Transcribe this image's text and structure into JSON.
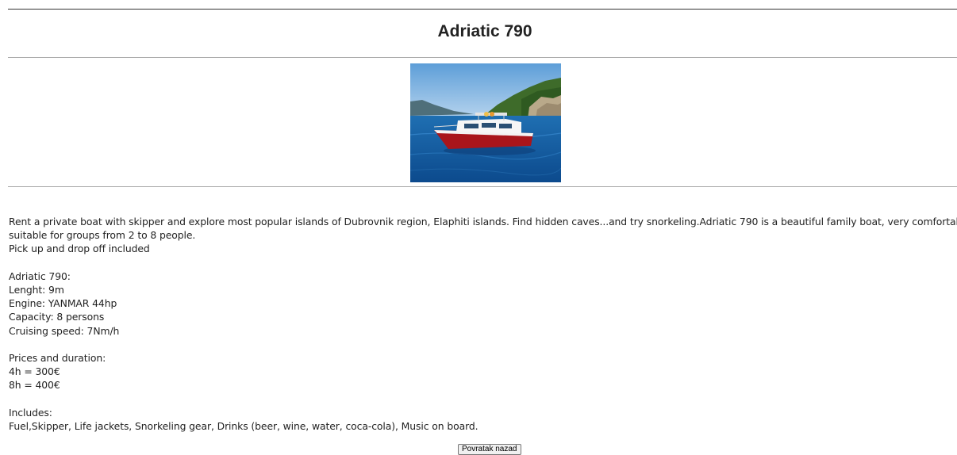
{
  "page": {
    "title": "Adriatic 790"
  },
  "image": {
    "description_icon": "boat-photo"
  },
  "description": {
    "intro_line1": "Rent a private boat with skipper and explore most popular islands of Dubrovnik region, Elaphiti islands. Find hidden caves...and try snorkeling.Adriatic 790 is a beautiful family boat, very comfortable and",
    "intro_line2": "suitable for groups from 2 to 8 people.",
    "intro_line3": "Pick up and drop off included"
  },
  "specs": {
    "heading": "Adriatic 790:",
    "length": "Lenght: 9m",
    "engine": "Engine: YANMAR 44hp",
    "capacity": "Capacity: 8 persons",
    "speed": "Cruising speed: 7Nm/h"
  },
  "prices": {
    "heading": "Prices and duration:",
    "short": "4h = 300€",
    "long": "8h = 400€"
  },
  "includes": {
    "heading": "Includes:",
    "items": "Fuel,Skipper, Life jackets, Snorkeling gear, Drinks (beer, wine, water, coca-cola), Music on board."
  },
  "actions": {
    "back_label": "Povratak nazad"
  }
}
